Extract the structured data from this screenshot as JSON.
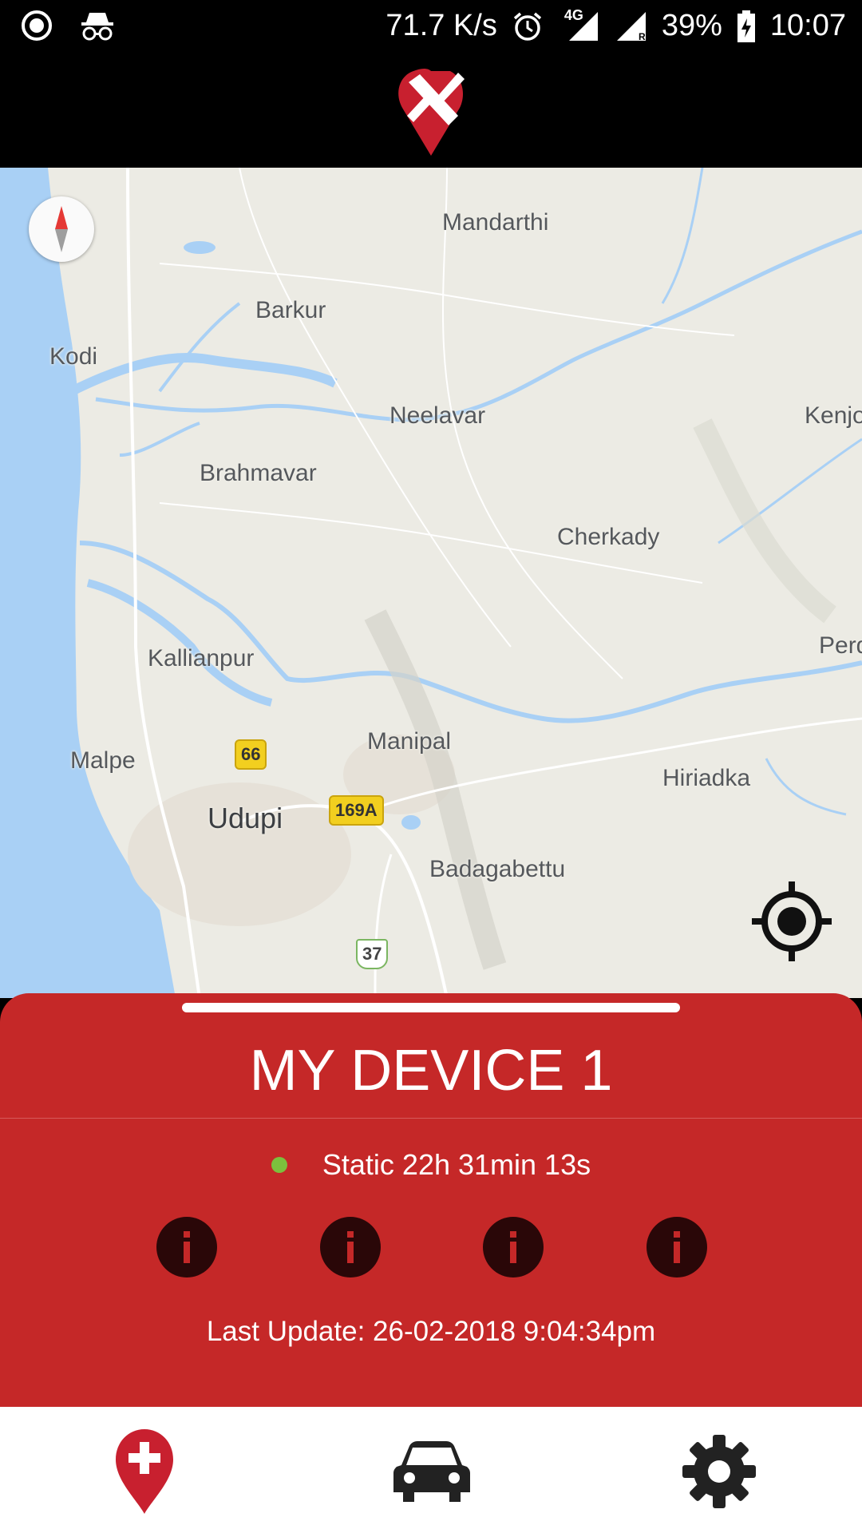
{
  "status_bar": {
    "network_speed": "71.7 K/s",
    "network_type": "4G",
    "battery": "39%",
    "time": "10:07",
    "icons": [
      "record-icon",
      "incognito-icon",
      "alarm-icon",
      "signal-icon",
      "battery-charging-icon"
    ]
  },
  "map": {
    "places": {
      "mandarthi": "Mandarthi",
      "barkur": "Barkur",
      "kodi": "Kodi",
      "neelavar": "Neelavar",
      "kenjo": "Kenjo",
      "brahmavar": "Brahmavar",
      "cherkady": "Cherkady",
      "kallianpur": "Kallianpur",
      "perd": "Perd",
      "manipal": "Manipal",
      "malpe": "Malpe",
      "hiriadka": "Hiriadka",
      "udupi": "Udupi",
      "badagabettu": "Badagabettu"
    },
    "shields": {
      "nh66": "66",
      "nh169a": "169A",
      "sh37": "37"
    }
  },
  "device": {
    "name": "MY DEVICE 1",
    "status": "Static 22h 31min 13s",
    "status_color": "#7cc03d",
    "last_update": "Last Update: 26-02-2018 9:04:34pm"
  },
  "colors": {
    "brand_red": "#c52828",
    "info_button": "#2a0708"
  },
  "nav": {
    "items": [
      "map-add-pin-icon",
      "car-icon",
      "gear-icon"
    ]
  }
}
